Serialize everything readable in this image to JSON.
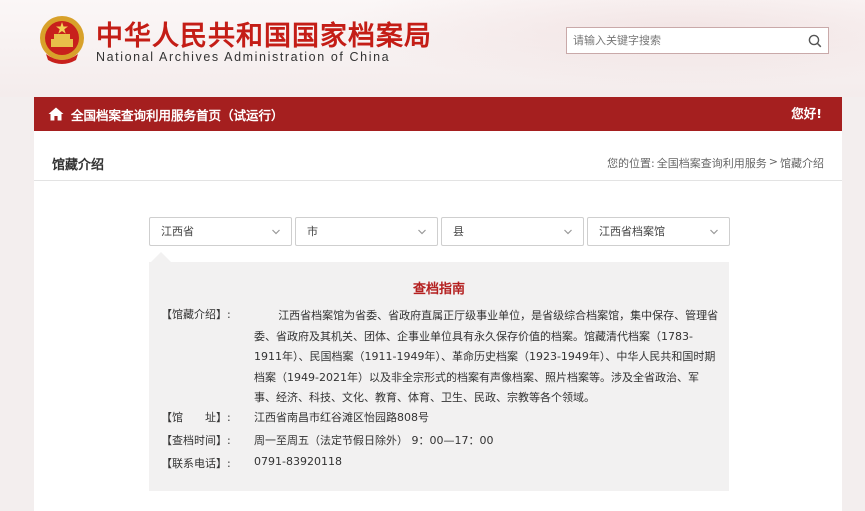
{
  "header": {
    "title_cn": "中华人民共和国国家档案局",
    "title_en": "National Archives Administration of China",
    "search_placeholder": "请输入关键字搜索"
  },
  "nav": {
    "home_label": "全国档案查询利用服务首页（试运行）",
    "greeting": "您好!"
  },
  "page": {
    "title": "馆藏介绍",
    "breadcrumb": {
      "prefix": "您的位置:",
      "items": [
        "全国档案查询利用服务",
        ">",
        "馆藏介绍"
      ]
    }
  },
  "filters": [
    "江西省",
    "市",
    "县",
    "江西省档案馆"
  ],
  "guide": {
    "title": "查档指南",
    "intro_label": "【馆藏介绍】:",
    "intro_text": "江西省档案馆为省委、省政府直属正厅级事业单位，是省级综合档案馆，集中保存、管理省委、省政府及其机关、团体、企事业单位具有永久保存价值的档案。馆藏清代档案（1783-1911年）、民国档案（1911-1949年）、革命历史档案（1923-1949年）、中华人民共和国时期档案（1949-2021年）以及非全宗形式的档案有声像档案、照片档案等。涉及全省政治、军事、经济、科技、文化、教育、体育、卫生、民政、宗教等各个领域。",
    "address_label": "【馆　　址】:",
    "address": "江西省南昌市红谷滩区怡园路808号",
    "hours_label": "【查档时间】:",
    "hours": "周一至周五（法定节假日除外） 9：00—17：00",
    "phone_label": "【联系电话】:",
    "phone": "0791-83920118"
  },
  "colors": {
    "brand_red": "#c41d16",
    "nav_bg": "#a51f1f",
    "guide_title": "#b42020"
  }
}
